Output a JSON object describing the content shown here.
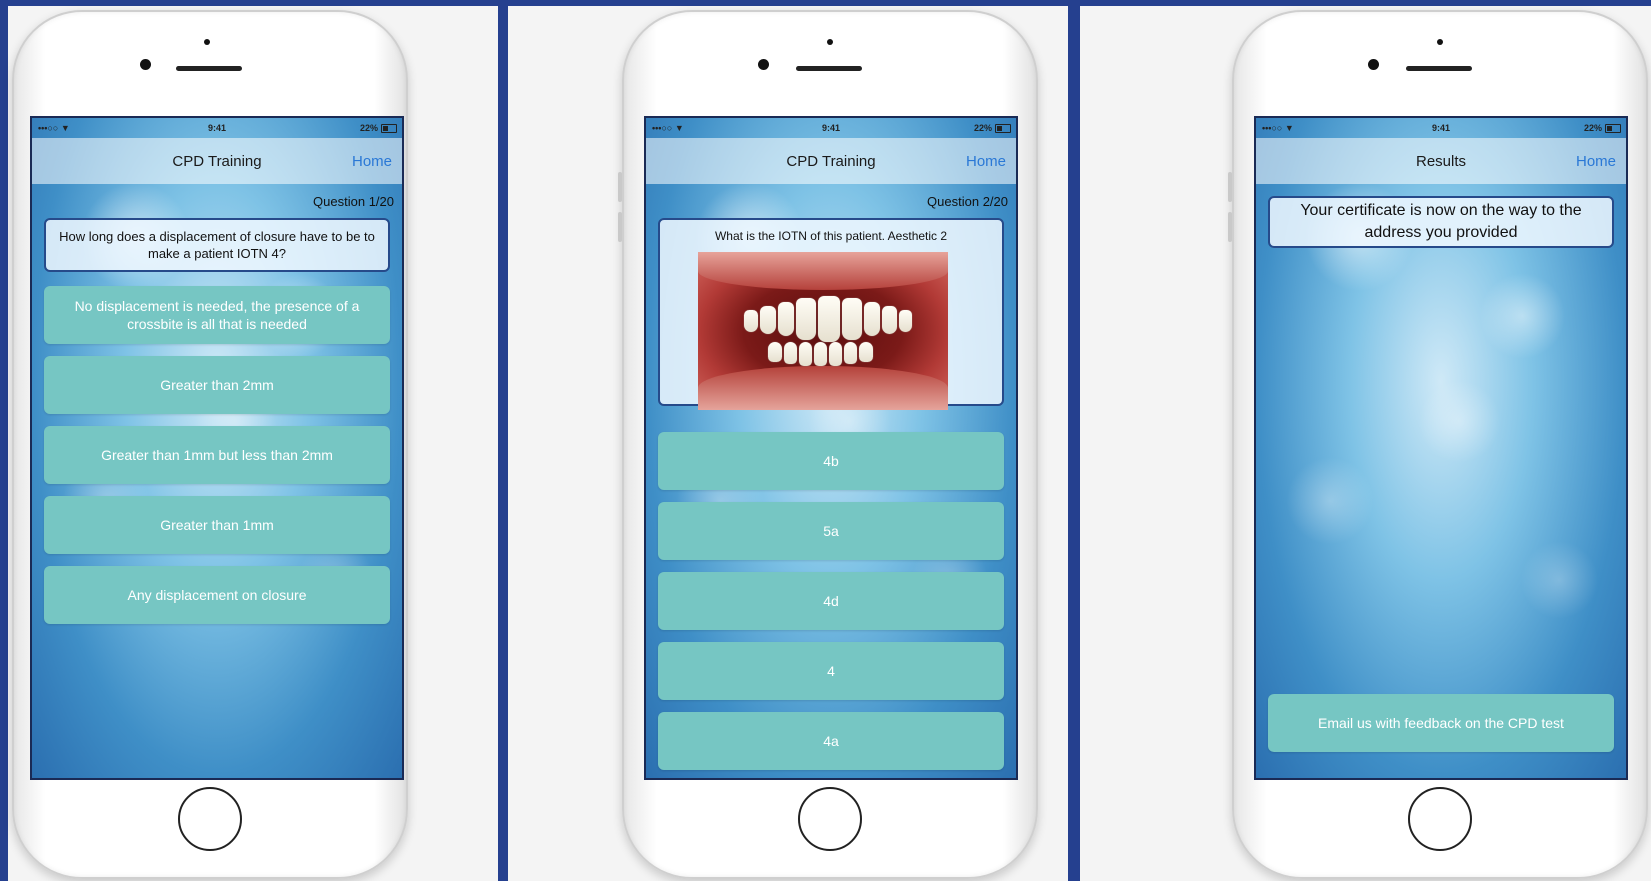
{
  "phones": [
    {
      "status": {
        "carrier": "•••○○ ▼",
        "time": "9:41",
        "battery": "22%"
      },
      "nav": {
        "title": "CPD Training",
        "home": "Home"
      },
      "counter": "Question 1/20",
      "question": "How long does a displacement of closure have to be to make a patient IOTN 4?",
      "answers": [
        "No displacement is needed, the presence of a crossbite is all that is needed",
        "Greater than 2mm",
        "Greater than 1mm but less than 2mm",
        "Greater than 1mm",
        "Any displacement on closure"
      ]
    },
    {
      "status": {
        "carrier": "•••○○ ▼",
        "time": "9:41",
        "battery": "22%"
      },
      "nav": {
        "title": "CPD Training",
        "home": "Home"
      },
      "counter": "Question 2/20",
      "question": "What is the IOTN of this patient. Aesthetic 2",
      "image_icon": "dental-photo",
      "answers": [
        "4b",
        "5a",
        "4d",
        "4",
        "4a"
      ]
    },
    {
      "status": {
        "carrier": "•••○○ ▼",
        "time": "9:41",
        "battery": "22%"
      },
      "nav": {
        "title": "Results",
        "home": "Home"
      },
      "certificate_message": "Your certificate is now on the way to the address you provided",
      "feedback_button": "Email us with feedback on the CPD test"
    }
  ]
}
